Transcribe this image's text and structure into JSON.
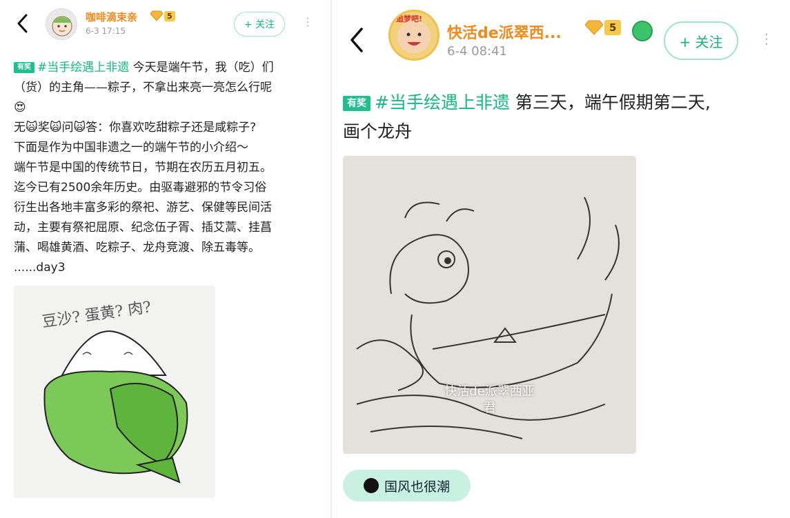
{
  "left_post": {
    "author": {
      "name": "咖啡滴束亲",
      "vip_level": "5",
      "time": "6-3 17:15"
    },
    "follow_label": "+ 关注",
    "badge": "有奖",
    "tag": "#当手绘遇上非遗",
    "lines": [
      "今天是端午节，我（吃）们",
      "（货）的主角——粽子，不拿出来亮一亮怎么行呢",
      "😍",
      "无🙀奖🙀问🙀答：你喜欢吃甜粽子还是咸粽子?",
      "下面是作为中国非遗之一的端午节的小介绍～",
      "端午节是中国的传统节日，节期在农历五月初五。",
      "迄今已有2500余年历史。由驱毒避邪的节令习俗",
      "衍生出各地丰富多彩的祭祀、游艺、保健等民间活",
      "动，主要有祭祀屈原、纪念伍子胥、插艾蒿、挂菖",
      "蒲、喝雄黄酒、吃粽子、龙舟竞渡、除五毒等。",
      "......day3"
    ],
    "image_handwriting": "豆沙? 蛋黄? 肉?"
  },
  "right_post": {
    "author": {
      "name": "快活de派翠西...",
      "vip_level": "5",
      "time": "6-4 08:41",
      "frame_text": "追梦吧!"
    },
    "follow_label": "+ 关注",
    "badge": "有奖",
    "tag": "#当手绘遇上非遗",
    "text_line1": " 第三天，端午假期第二天,",
    "text_line2": "画个龙舟",
    "watermark": "快活de派翠西亚\n君",
    "topic": "国风也很潮"
  },
  "colors": {
    "tag_green": "#18b883",
    "username_orange": "#f08a1e",
    "topic_bg": "#c9f1e2"
  }
}
